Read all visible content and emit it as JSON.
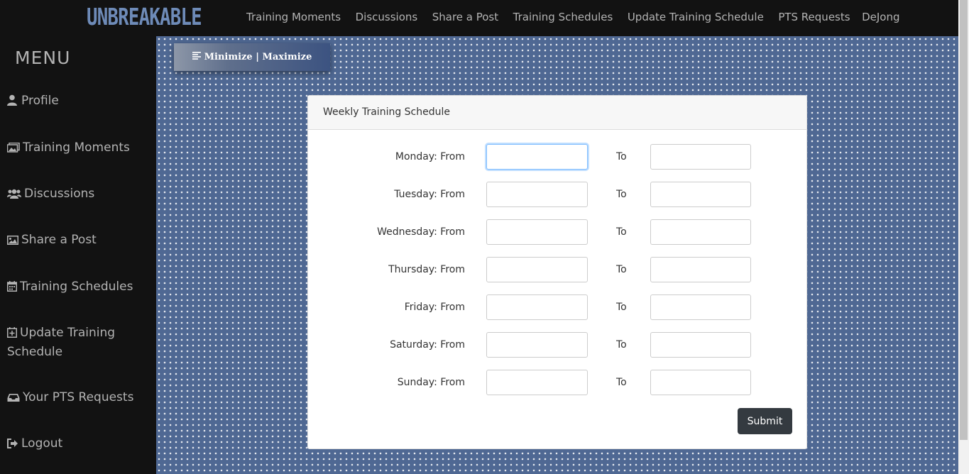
{
  "brand": {
    "logo_text": "UNBREAKABLE"
  },
  "topnav": {
    "items": [
      "Training Moments",
      "Discussions",
      "Share a Post",
      "Training Schedules",
      "Update Training Schedule",
      "PTS Requests"
    ],
    "user": "DeJong"
  },
  "sidebar": {
    "title": "MENU",
    "items": [
      {
        "label": "Profile",
        "icon": "user-icon"
      },
      {
        "label": "Training Moments",
        "icon": "images-icon"
      },
      {
        "label": "Discussions",
        "icon": "users-icon"
      },
      {
        "label": "Share a Post",
        "icon": "image-icon"
      },
      {
        "label": "Training Schedules",
        "icon": "calendar-icon"
      },
      {
        "label": "Update Training Schedule",
        "icon": "calendar-plus-icon"
      },
      {
        "label": "Your PTS Requests",
        "icon": "inbox-icon"
      },
      {
        "label": "Logout",
        "icon": "sign-out-icon"
      }
    ]
  },
  "toggle": {
    "label": "Minimize | Maximize"
  },
  "schedule": {
    "title": "Weekly Training Schedule",
    "to_label": "To",
    "days": [
      {
        "label": "Monday: From",
        "from": "",
        "to": ""
      },
      {
        "label": "Tuesday: From",
        "from": "",
        "to": ""
      },
      {
        "label": "Wednesday: From",
        "from": "",
        "to": ""
      },
      {
        "label": "Thursday: From",
        "from": "",
        "to": ""
      },
      {
        "label": "Friday: From",
        "from": "",
        "to": ""
      },
      {
        "label": "Saturday: From",
        "from": "",
        "to": ""
      },
      {
        "label": "Sunday: From",
        "from": "",
        "to": ""
      }
    ],
    "submit_label": "Submit"
  },
  "colors": {
    "background_blue": "#4f6893",
    "logo_blue": "#6e8bb8",
    "dark": "#121212",
    "submit": "#343a40"
  }
}
